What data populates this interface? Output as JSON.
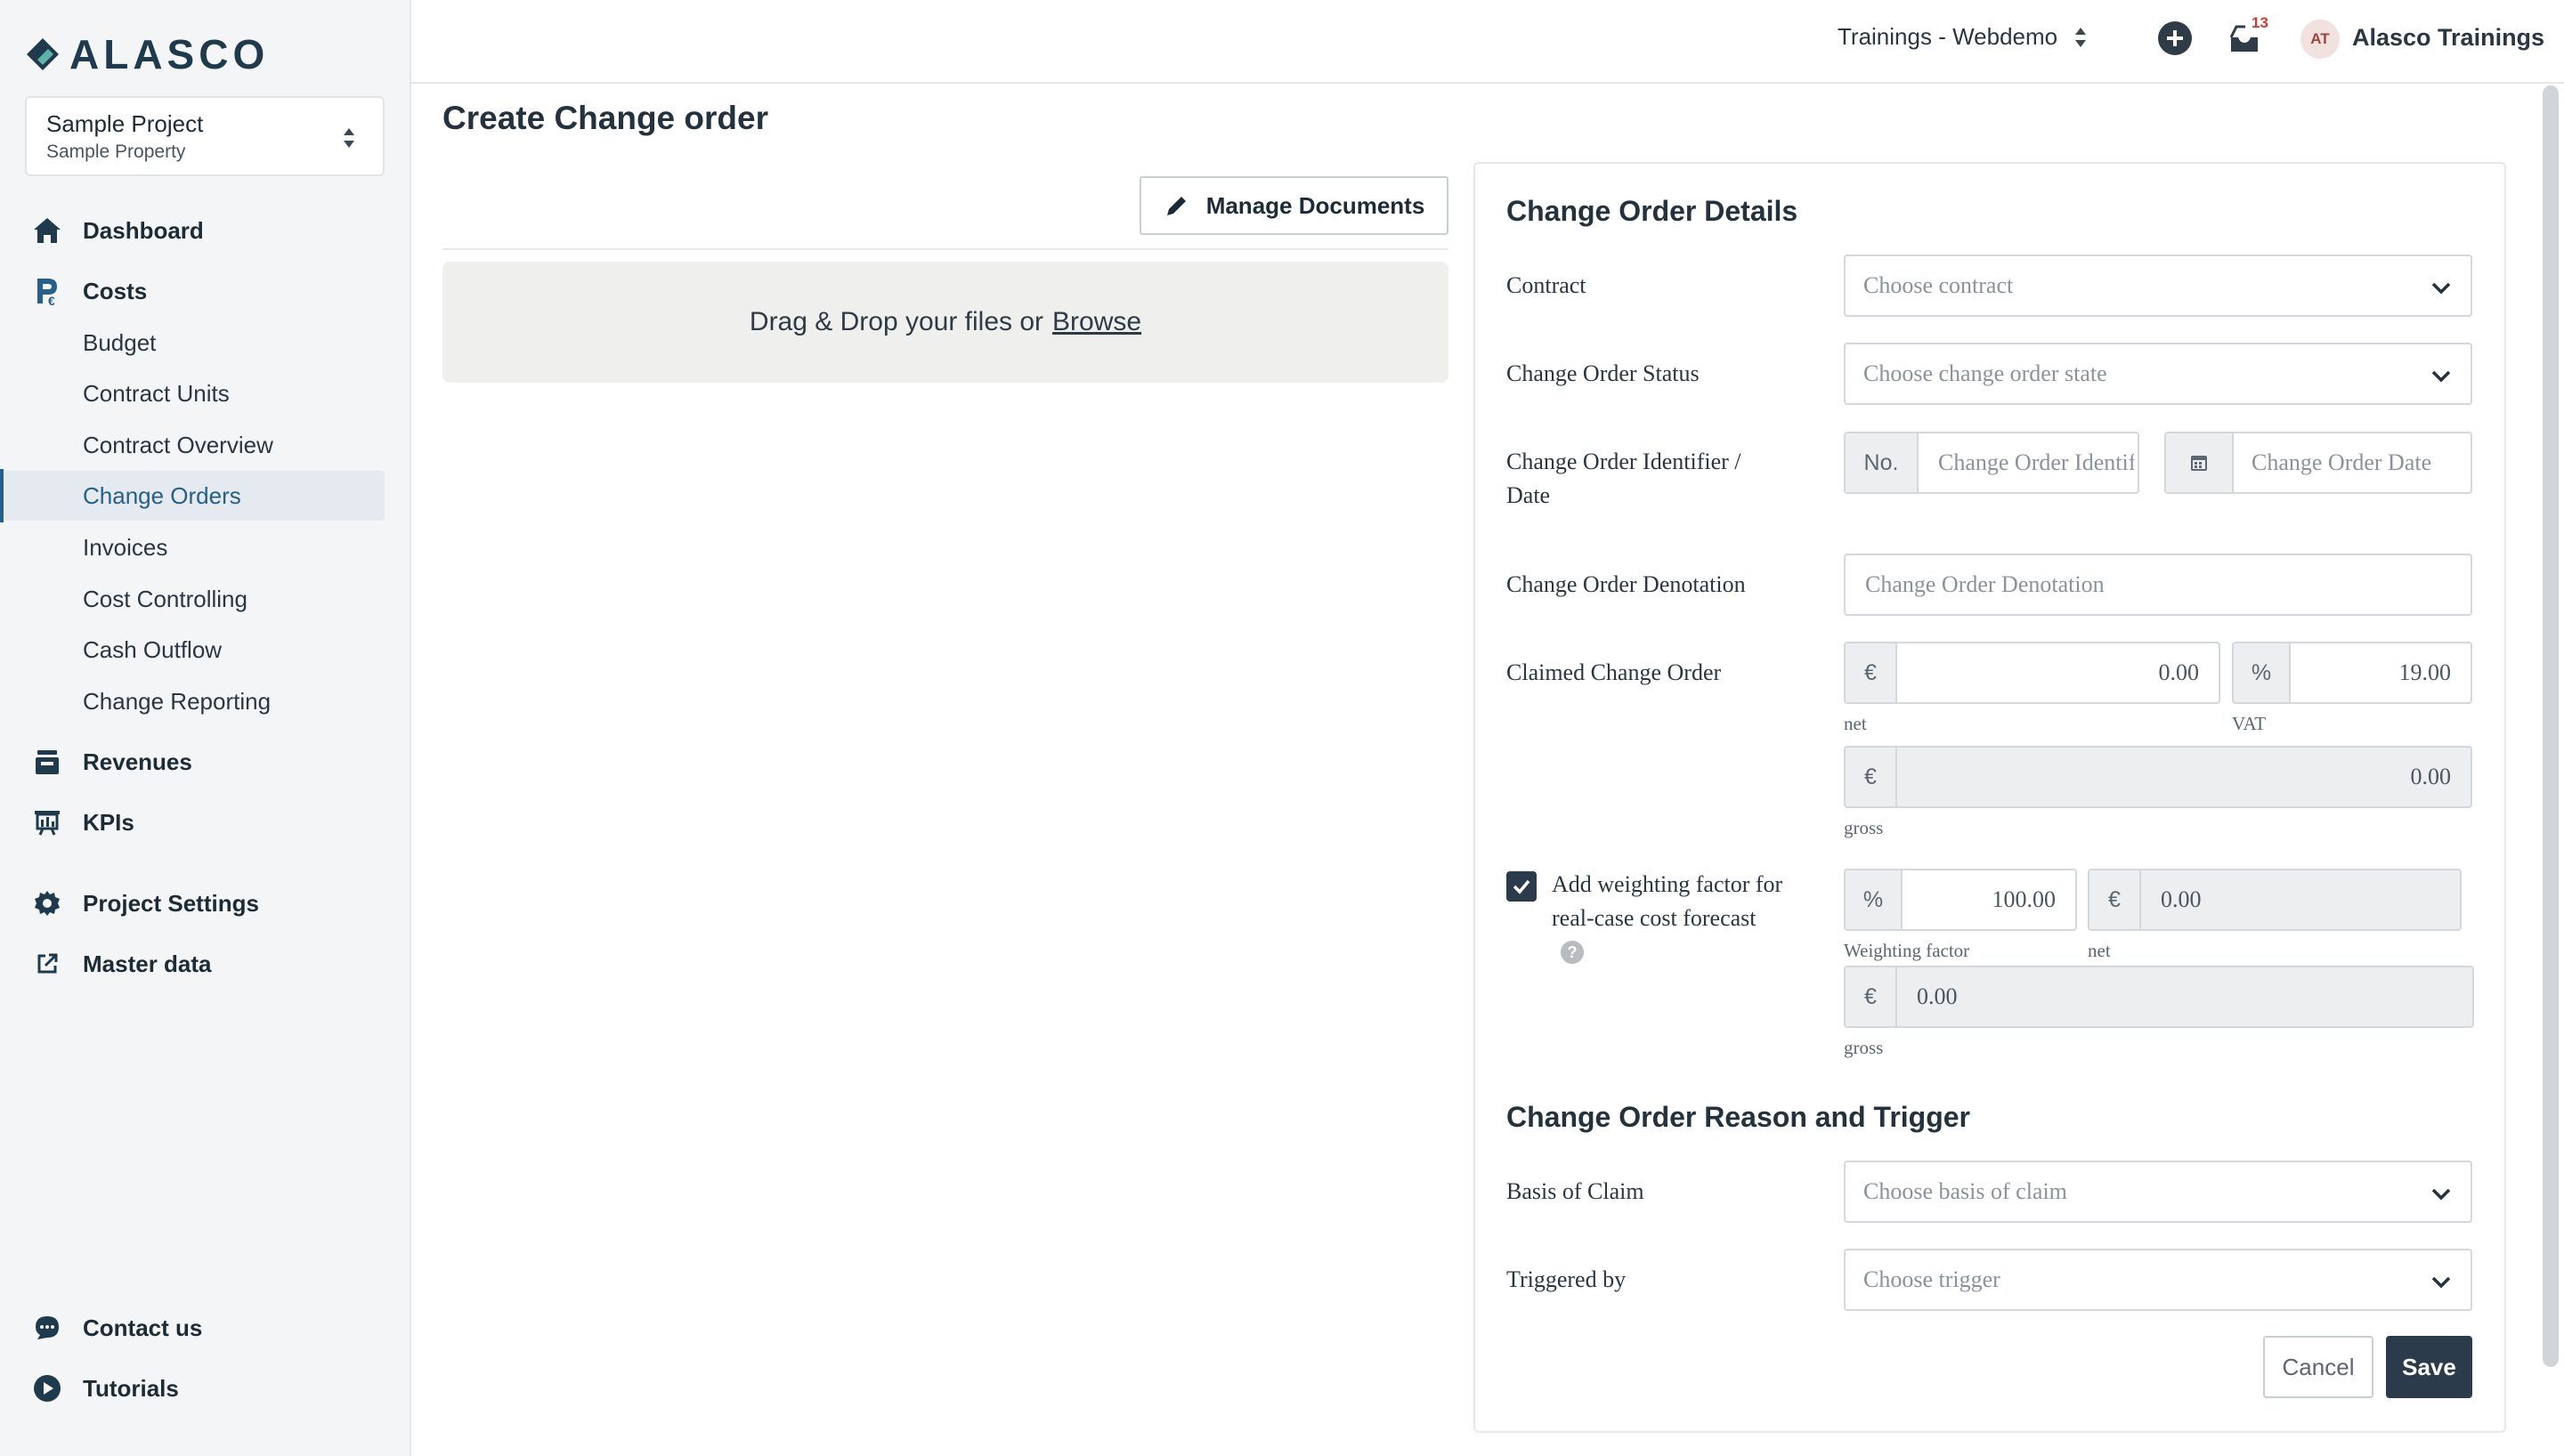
{
  "brand": {
    "name": "ALASCO"
  },
  "project": {
    "name": "Sample Project",
    "property": "Sample Property"
  },
  "nav": {
    "dashboard": "Dashboard",
    "costs": "Costs",
    "costs_items": [
      "Budget",
      "Contract Units",
      "Contract Overview",
      "Change Orders",
      "Invoices",
      "Cost Controlling",
      "Cash Outflow",
      "Change Reporting"
    ],
    "revenues": "Revenues",
    "kpis": "KPIs",
    "project_settings": "Project Settings",
    "master_data": "Master data",
    "contact": "Contact us",
    "tutorials": "Tutorials"
  },
  "topbar": {
    "workspace": "Trainings - Webdemo",
    "notifications_count": "13",
    "avatar_initials": "AT",
    "user_name": "Alasco Trainings"
  },
  "page": {
    "title": "Create Change order",
    "manage_documents": "Manage Documents",
    "dropzone_text": "Drag & Drop your files or",
    "dropzone_link": "Browse"
  },
  "form": {
    "details_title": "Change Order Details",
    "contract_label": "Contract",
    "contract_placeholder": "Choose contract",
    "status_label": "Change Order Status",
    "status_placeholder": "Choose change order state",
    "identifier_label_1": "Change Order Identifier /",
    "identifier_label_2": "Date",
    "identifier_prefix": "No.",
    "identifier_placeholder": "Change Order Identifier",
    "date_placeholder": "Change Order Date",
    "denotation_label": "Change Order Denotation",
    "denotation_placeholder": "Change Order Denotation",
    "claimed_label": "Claimed Change Order",
    "currency": "€",
    "percent": "%",
    "net_value": "0.00",
    "vat_value": "19.00",
    "net_hint": "net",
    "vat_hint": "VAT",
    "gross_value": "0.00",
    "gross_hint": "gross",
    "weighting_label_1": "Add weighting factor for",
    "weighting_label_2": "real-case cost forecast",
    "weighting_checked": true,
    "help_icon": "?",
    "weighting_value": "100.00",
    "weighting_hint": "Weighting factor",
    "weighted_net_value": "0.00",
    "weighted_net_hint": "net",
    "weighted_gross_value": "0.00",
    "weighted_gross_hint": "gross",
    "reason_title": "Change Order Reason and Trigger",
    "basis_label": "Basis of Claim",
    "basis_placeholder": "Choose basis of claim",
    "trigger_label": "Triggered by",
    "trigger_placeholder": "Choose trigger",
    "cancel": "Cancel",
    "save": "Save"
  },
  "colors": {
    "accent": "#255f8a",
    "primary_button": "#2b3b4c",
    "badge": "#d33a2c"
  }
}
